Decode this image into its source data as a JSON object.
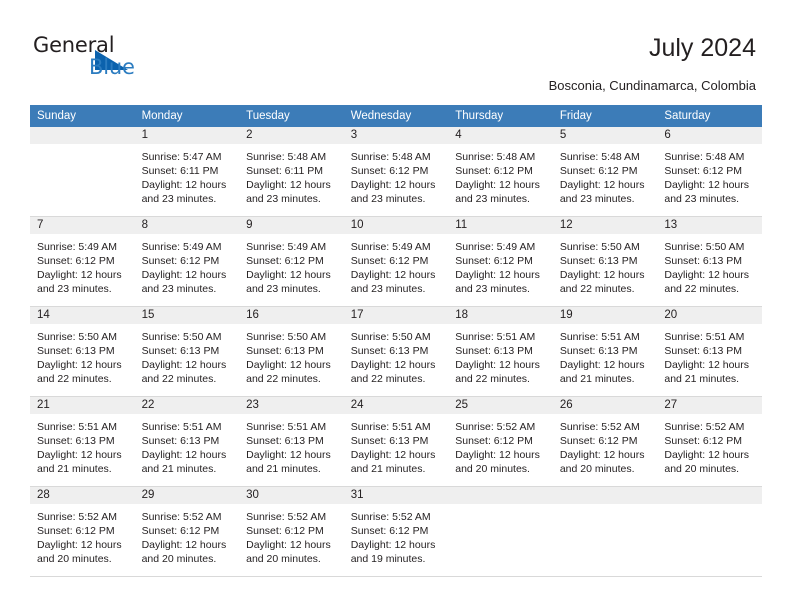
{
  "brand": {
    "name_part1": "General",
    "name_part2": "Blue",
    "accent_color": "#0b62ad",
    "blue_text_color": "#2b7cc0"
  },
  "header": {
    "title": "July 2024",
    "location": "Bosconia, Cundinamarca, Colombia"
  },
  "calendar": {
    "header_bg": "#3c7cb8",
    "daynum_bg": "#efefef",
    "weekdays": [
      "Sunday",
      "Monday",
      "Tuesday",
      "Wednesday",
      "Thursday",
      "Friday",
      "Saturday"
    ],
    "weeks": [
      [
        {
          "day": "",
          "sunrise": "",
          "sunset": "",
          "daylight1": "",
          "daylight2": ""
        },
        {
          "day": "1",
          "sunrise": "Sunrise: 5:47 AM",
          "sunset": "Sunset: 6:11 PM",
          "daylight1": "Daylight: 12 hours",
          "daylight2": "and 23 minutes."
        },
        {
          "day": "2",
          "sunrise": "Sunrise: 5:48 AM",
          "sunset": "Sunset: 6:11 PM",
          "daylight1": "Daylight: 12 hours",
          "daylight2": "and 23 minutes."
        },
        {
          "day": "3",
          "sunrise": "Sunrise: 5:48 AM",
          "sunset": "Sunset: 6:12 PM",
          "daylight1": "Daylight: 12 hours",
          "daylight2": "and 23 minutes."
        },
        {
          "day": "4",
          "sunrise": "Sunrise: 5:48 AM",
          "sunset": "Sunset: 6:12 PM",
          "daylight1": "Daylight: 12 hours",
          "daylight2": "and 23 minutes."
        },
        {
          "day": "5",
          "sunrise": "Sunrise: 5:48 AM",
          "sunset": "Sunset: 6:12 PM",
          "daylight1": "Daylight: 12 hours",
          "daylight2": "and 23 minutes."
        },
        {
          "day": "6",
          "sunrise": "Sunrise: 5:48 AM",
          "sunset": "Sunset: 6:12 PM",
          "daylight1": "Daylight: 12 hours",
          "daylight2": "and 23 minutes."
        }
      ],
      [
        {
          "day": "7",
          "sunrise": "Sunrise: 5:49 AM",
          "sunset": "Sunset: 6:12 PM",
          "daylight1": "Daylight: 12 hours",
          "daylight2": "and 23 minutes."
        },
        {
          "day": "8",
          "sunrise": "Sunrise: 5:49 AM",
          "sunset": "Sunset: 6:12 PM",
          "daylight1": "Daylight: 12 hours",
          "daylight2": "and 23 minutes."
        },
        {
          "day": "9",
          "sunrise": "Sunrise: 5:49 AM",
          "sunset": "Sunset: 6:12 PM",
          "daylight1": "Daylight: 12 hours",
          "daylight2": "and 23 minutes."
        },
        {
          "day": "10",
          "sunrise": "Sunrise: 5:49 AM",
          "sunset": "Sunset: 6:12 PM",
          "daylight1": "Daylight: 12 hours",
          "daylight2": "and 23 minutes."
        },
        {
          "day": "11",
          "sunrise": "Sunrise: 5:49 AM",
          "sunset": "Sunset: 6:12 PM",
          "daylight1": "Daylight: 12 hours",
          "daylight2": "and 23 minutes."
        },
        {
          "day": "12",
          "sunrise": "Sunrise: 5:50 AM",
          "sunset": "Sunset: 6:13 PM",
          "daylight1": "Daylight: 12 hours",
          "daylight2": "and 22 minutes."
        },
        {
          "day": "13",
          "sunrise": "Sunrise: 5:50 AM",
          "sunset": "Sunset: 6:13 PM",
          "daylight1": "Daylight: 12 hours",
          "daylight2": "and 22 minutes."
        }
      ],
      [
        {
          "day": "14",
          "sunrise": "Sunrise: 5:50 AM",
          "sunset": "Sunset: 6:13 PM",
          "daylight1": "Daylight: 12 hours",
          "daylight2": "and 22 minutes."
        },
        {
          "day": "15",
          "sunrise": "Sunrise: 5:50 AM",
          "sunset": "Sunset: 6:13 PM",
          "daylight1": "Daylight: 12 hours",
          "daylight2": "and 22 minutes."
        },
        {
          "day": "16",
          "sunrise": "Sunrise: 5:50 AM",
          "sunset": "Sunset: 6:13 PM",
          "daylight1": "Daylight: 12 hours",
          "daylight2": "and 22 minutes."
        },
        {
          "day": "17",
          "sunrise": "Sunrise: 5:50 AM",
          "sunset": "Sunset: 6:13 PM",
          "daylight1": "Daylight: 12 hours",
          "daylight2": "and 22 minutes."
        },
        {
          "day": "18",
          "sunrise": "Sunrise: 5:51 AM",
          "sunset": "Sunset: 6:13 PM",
          "daylight1": "Daylight: 12 hours",
          "daylight2": "and 22 minutes."
        },
        {
          "day": "19",
          "sunrise": "Sunrise: 5:51 AM",
          "sunset": "Sunset: 6:13 PM",
          "daylight1": "Daylight: 12 hours",
          "daylight2": "and 21 minutes."
        },
        {
          "day": "20",
          "sunrise": "Sunrise: 5:51 AM",
          "sunset": "Sunset: 6:13 PM",
          "daylight1": "Daylight: 12 hours",
          "daylight2": "and 21 minutes."
        }
      ],
      [
        {
          "day": "21",
          "sunrise": "Sunrise: 5:51 AM",
          "sunset": "Sunset: 6:13 PM",
          "daylight1": "Daylight: 12 hours",
          "daylight2": "and 21 minutes."
        },
        {
          "day": "22",
          "sunrise": "Sunrise: 5:51 AM",
          "sunset": "Sunset: 6:13 PM",
          "daylight1": "Daylight: 12 hours",
          "daylight2": "and 21 minutes."
        },
        {
          "day": "23",
          "sunrise": "Sunrise: 5:51 AM",
          "sunset": "Sunset: 6:13 PM",
          "daylight1": "Daylight: 12 hours",
          "daylight2": "and 21 minutes."
        },
        {
          "day": "24",
          "sunrise": "Sunrise: 5:51 AM",
          "sunset": "Sunset: 6:13 PM",
          "daylight1": "Daylight: 12 hours",
          "daylight2": "and 21 minutes."
        },
        {
          "day": "25",
          "sunrise": "Sunrise: 5:52 AM",
          "sunset": "Sunset: 6:12 PM",
          "daylight1": "Daylight: 12 hours",
          "daylight2": "and 20 minutes."
        },
        {
          "day": "26",
          "sunrise": "Sunrise: 5:52 AM",
          "sunset": "Sunset: 6:12 PM",
          "daylight1": "Daylight: 12 hours",
          "daylight2": "and 20 minutes."
        },
        {
          "day": "27",
          "sunrise": "Sunrise: 5:52 AM",
          "sunset": "Sunset: 6:12 PM",
          "daylight1": "Daylight: 12 hours",
          "daylight2": "and 20 minutes."
        }
      ],
      [
        {
          "day": "28",
          "sunrise": "Sunrise: 5:52 AM",
          "sunset": "Sunset: 6:12 PM",
          "daylight1": "Daylight: 12 hours",
          "daylight2": "and 20 minutes."
        },
        {
          "day": "29",
          "sunrise": "Sunrise: 5:52 AM",
          "sunset": "Sunset: 6:12 PM",
          "daylight1": "Daylight: 12 hours",
          "daylight2": "and 20 minutes."
        },
        {
          "day": "30",
          "sunrise": "Sunrise: 5:52 AM",
          "sunset": "Sunset: 6:12 PM",
          "daylight1": "Daylight: 12 hours",
          "daylight2": "and 20 minutes."
        },
        {
          "day": "31",
          "sunrise": "Sunrise: 5:52 AM",
          "sunset": "Sunset: 6:12 PM",
          "daylight1": "Daylight: 12 hours",
          "daylight2": "and 19 minutes."
        },
        {
          "day": "",
          "sunrise": "",
          "sunset": "",
          "daylight1": "",
          "daylight2": ""
        },
        {
          "day": "",
          "sunrise": "",
          "sunset": "",
          "daylight1": "",
          "daylight2": ""
        },
        {
          "day": "",
          "sunrise": "",
          "sunset": "",
          "daylight1": "",
          "daylight2": ""
        }
      ]
    ]
  }
}
